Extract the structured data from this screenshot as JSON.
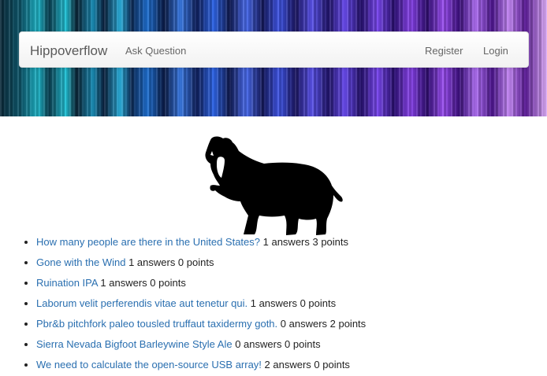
{
  "navbar": {
    "brand": "Hippoverflow",
    "ask_question": "Ask Question",
    "register": "Register",
    "login": "Login"
  },
  "questions": [
    {
      "title": "How many people are there in the United States?",
      "meta": " 1 answers 3 points"
    },
    {
      "title": "Gone with the Wind",
      "meta": " 1 answers 0 points"
    },
    {
      "title": "Ruination IPA",
      "meta": " 1 answers 0 points"
    },
    {
      "title": "Laborum velit perferendis vitae aut tenetur qui.",
      "meta": " 1 answers 0 points"
    },
    {
      "title": "Pbr&b pitchfork paleo tousled truffaut taxidermy goth.",
      "meta": " 0 answers 2 points"
    },
    {
      "title": "Sierra Nevada Bigfoot Barleywine Style Ale",
      "meta": " 0 answers 0 points"
    },
    {
      "title": "We need to calculate the open-source USB array!",
      "meta": " 2 answers 0 points"
    }
  ],
  "icons": {
    "logo": "hippo-silhouette-icon"
  }
}
